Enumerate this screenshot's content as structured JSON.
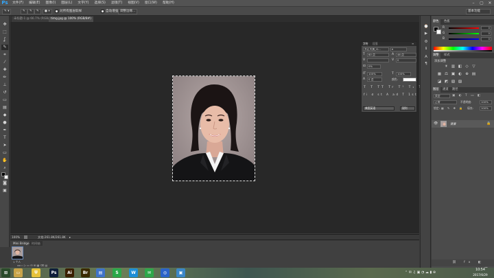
{
  "app": {
    "logo": "Ps",
    "menu": [
      "文件(F)",
      "编辑(E)",
      "图像(I)",
      "图层(L)",
      "文字(Y)",
      "选择(S)",
      "滤镜(T)",
      "视图(V)",
      "窗口(W)",
      "帮助(H)"
    ],
    "window_controls": [
      "minimize-icon",
      "maximize-icon",
      "close-icon"
    ]
  },
  "options_bar": {
    "checkbox_label": "对所有图层取样",
    "auto_enhance": "自动增强",
    "refine_edge": "调整边缘...",
    "workspace": "基本功能"
  },
  "tabs": {
    "doc1": "未标题-1 @ 66.7% (RGB/8)",
    "doc2": "timg.jpg @ 100% (RGB/8#)"
  },
  "status": {
    "zoom": "100%",
    "doc_size": "文档:261.8K/261.8K"
  },
  "mini_bridge": {
    "tabs": [
      "Mini Bridge",
      "时间轴"
    ],
    "thumb_label": "1 个人"
  },
  "character_panel": {
    "tabs": [
      "字符",
      "段落"
    ],
    "font_family": "方正大黑_G...",
    "font_size": "60 点",
    "leading": "46 点",
    "kerning": "",
    "tracking": "0",
    "scale_pct": "0%",
    "vscale": "100%",
    "hscale": "100%",
    "baseline": "0 点",
    "color_label": "颜色:",
    "lang": "美国英语",
    "aa": "锐利",
    "style_buttons": [
      "T",
      "T",
      "TT",
      "Tr",
      "T¹",
      "T₁",
      "T",
      "T"
    ],
    "extra_buttons": [
      "fi",
      "ơ",
      "st",
      "A",
      "ad",
      "T",
      "1st",
      "½"
    ]
  },
  "color_panel": {
    "tabs": [
      "颜色",
      "色板"
    ],
    "channels": [
      {
        "label": "R",
        "value": "0",
        "color": "#e03030"
      },
      {
        "label": "G",
        "value": "0",
        "color": "#30c030"
      },
      {
        "label": "B",
        "value": "0",
        "color": "#3050e0"
      }
    ]
  },
  "adjust_panel": {
    "tabs": [
      "调整",
      "样式"
    ],
    "title": "添加调整",
    "icons_row1": [
      "☀",
      "▥",
      "◧",
      "◇",
      "▽"
    ],
    "icons_row2": [
      "▦",
      "⚖",
      "▣",
      "◐",
      "⊕",
      "▤"
    ],
    "icons_row3": [
      "◪",
      "◩",
      "▧",
      "▨"
    ]
  },
  "layers_panel": {
    "tabs": [
      "图层",
      "通道",
      "路径"
    ],
    "kind": "类型",
    "blend": "正常",
    "opacity_label": "不透明度:",
    "opacity": "100%",
    "lock_label": "锁定:",
    "fill_label": "填充:",
    "fill": "100%",
    "layer_name": "背景"
  },
  "taskbar": {
    "icons": [
      {
        "name": "start-icon",
        "glyph": "⊞",
        "bg": "#2a4a2a"
      },
      {
        "name": "file-explorer-icon",
        "glyph": "▭",
        "bg": "#c9a44a"
      },
      {
        "name": "shield-icon",
        "glyph": "⛨",
        "bg": "#e6c23a"
      },
      {
        "name": "ie-icon",
        "glyph": "e",
        "bg": "#2e6bc6"
      },
      {
        "name": "photoshop-icon",
        "glyph": "Ps",
        "bg": "#0f1f3a"
      },
      {
        "name": "illustrator-icon",
        "glyph": "Ai",
        "bg": "#3a1f00"
      },
      {
        "name": "bridge-icon",
        "glyph": "Br",
        "bg": "#3a2a00"
      },
      {
        "name": "document-icon",
        "glyph": "▤",
        "bg": "#3f74c9"
      },
      {
        "name": "green-app-icon",
        "glyph": "S",
        "bg": "#2aa84a"
      },
      {
        "name": "w-app-icon",
        "glyph": "W",
        "bg": "#1e8fd6"
      },
      {
        "name": "wechat-icon",
        "glyph": "✉",
        "bg": "#2ea84a"
      },
      {
        "name": "blue-app-icon",
        "glyph": "◎",
        "bg": "#2b63c9"
      },
      {
        "name": "image-app-icon",
        "glyph": "▣",
        "bg": "#3b87c8"
      }
    ],
    "time": "10:54",
    "date": "2017/6/29"
  }
}
